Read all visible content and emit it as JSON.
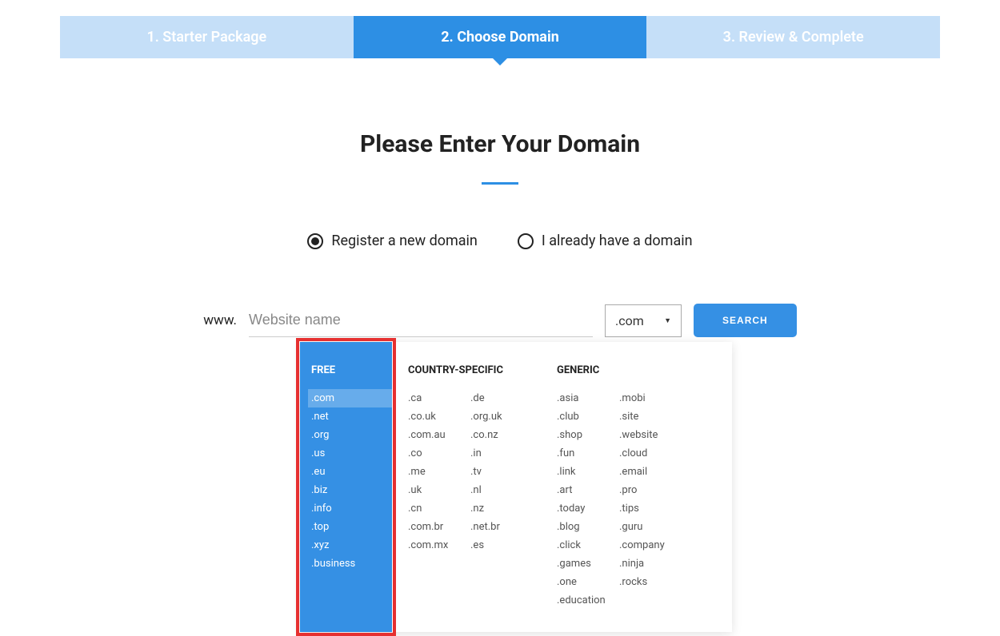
{
  "steps": {
    "step1": "1. Starter Package",
    "step2": "2. Choose Domain",
    "step3": "3. Review & Complete"
  },
  "heading": "Please Enter Your Domain",
  "radio": {
    "register": "Register a new domain",
    "existing": "I already have a domain"
  },
  "search": {
    "www": "www.",
    "placeholder": "Website name",
    "tld_selected": ".com",
    "button": "SEARCH"
  },
  "dropdown": {
    "free_title": "FREE",
    "free": [
      ".com",
      ".net",
      ".org",
      ".us",
      ".eu",
      ".biz",
      ".info",
      ".top",
      ".xyz",
      ".business"
    ],
    "country_title": "COUNTRY-SPECIFIC",
    "country_col1": [
      ".ca",
      ".co.uk",
      ".com.au",
      ".co",
      ".me",
      ".uk",
      ".cn",
      ".com.br",
      ".com.mx"
    ],
    "country_col2": [
      ".de",
      ".org.uk",
      ".co.nz",
      ".in",
      ".tv",
      ".nl",
      ".nz",
      ".net.br",
      ".es"
    ],
    "generic_title": "GENERIC",
    "generic_col1": [
      ".asia",
      ".club",
      ".shop",
      ".fun",
      ".link",
      ".art",
      ".today",
      ".blog",
      ".click",
      ".games",
      ".one",
      ".education"
    ],
    "generic_col2": [
      ".mobi",
      ".site",
      ".website",
      ".cloud",
      ".email",
      ".pro",
      ".tips",
      ".guru",
      ".company",
      ".ninja",
      ".rocks"
    ]
  }
}
